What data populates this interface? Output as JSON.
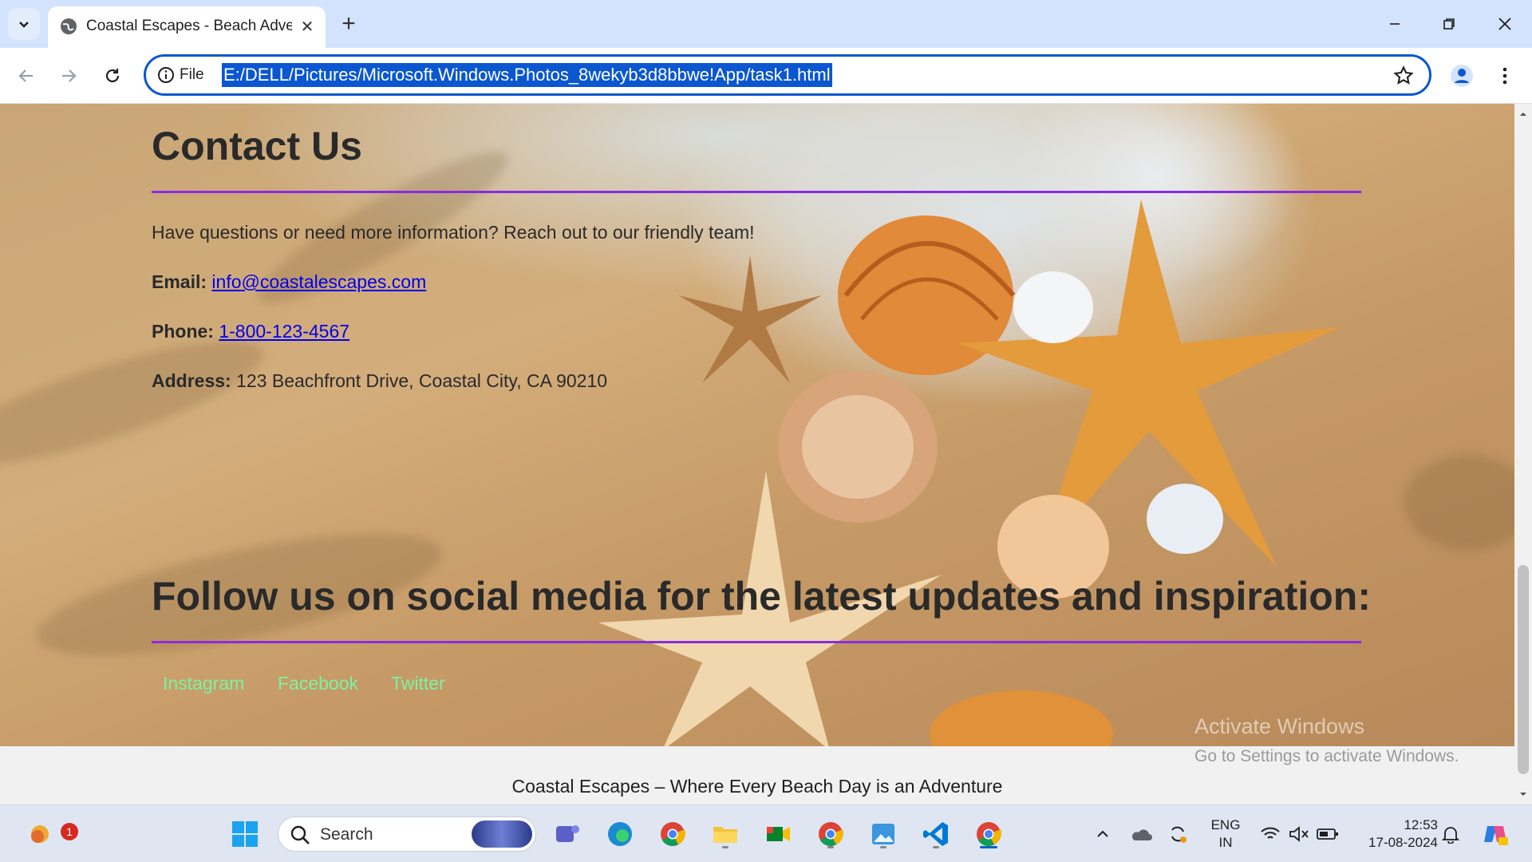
{
  "browser": {
    "tab_title": "Coastal Escapes - Beach Advent",
    "tab_close": "✕",
    "new_tab": "+",
    "omnibox_scheme": "File",
    "url": "E:/DELL/Pictures/Microsoft.Windows.Photos_8wekyb3d8bbwe!App/task1.html",
    "accent_color": "#0b57d0"
  },
  "page": {
    "contact_heading": "Contact Us",
    "intro": "Have questions or need more information? Reach out to our friendly team!",
    "email_label": "Email:",
    "email_value": "info@coastalescapes.com",
    "phone_label": "Phone:",
    "phone_value": "1-800-123-4567",
    "address_label": "Address:",
    "address_value": "123 Beachfront Drive, Coastal City, CA 90210",
    "follow_heading": "Follow us on social media for the latest updates and inspiration:",
    "social_links": [
      "Instagram",
      "Facebook",
      "Twitter"
    ],
    "rule_color": "#8a2be2",
    "link_color": "#0000ee",
    "social_color": "#7cf3a0",
    "footer": "Coastal Escapes – Where Every Beach Day is an Adventure"
  },
  "watermark": {
    "line1": "Activate Windows",
    "line2": "Go to Settings to activate Windows."
  },
  "taskbar": {
    "search_label": "Search",
    "notification_badge": "1",
    "language_line1": "ENG",
    "language_line2": "IN",
    "time": "12:53",
    "date": "17-08-2024",
    "apps": [
      "teams-icon",
      "edge-icon",
      "chrome-icon",
      "file-explorer-icon",
      "meet-icon",
      "chrome-icon",
      "photos-icon",
      "vscode-icon",
      "chrome-active-icon"
    ]
  }
}
